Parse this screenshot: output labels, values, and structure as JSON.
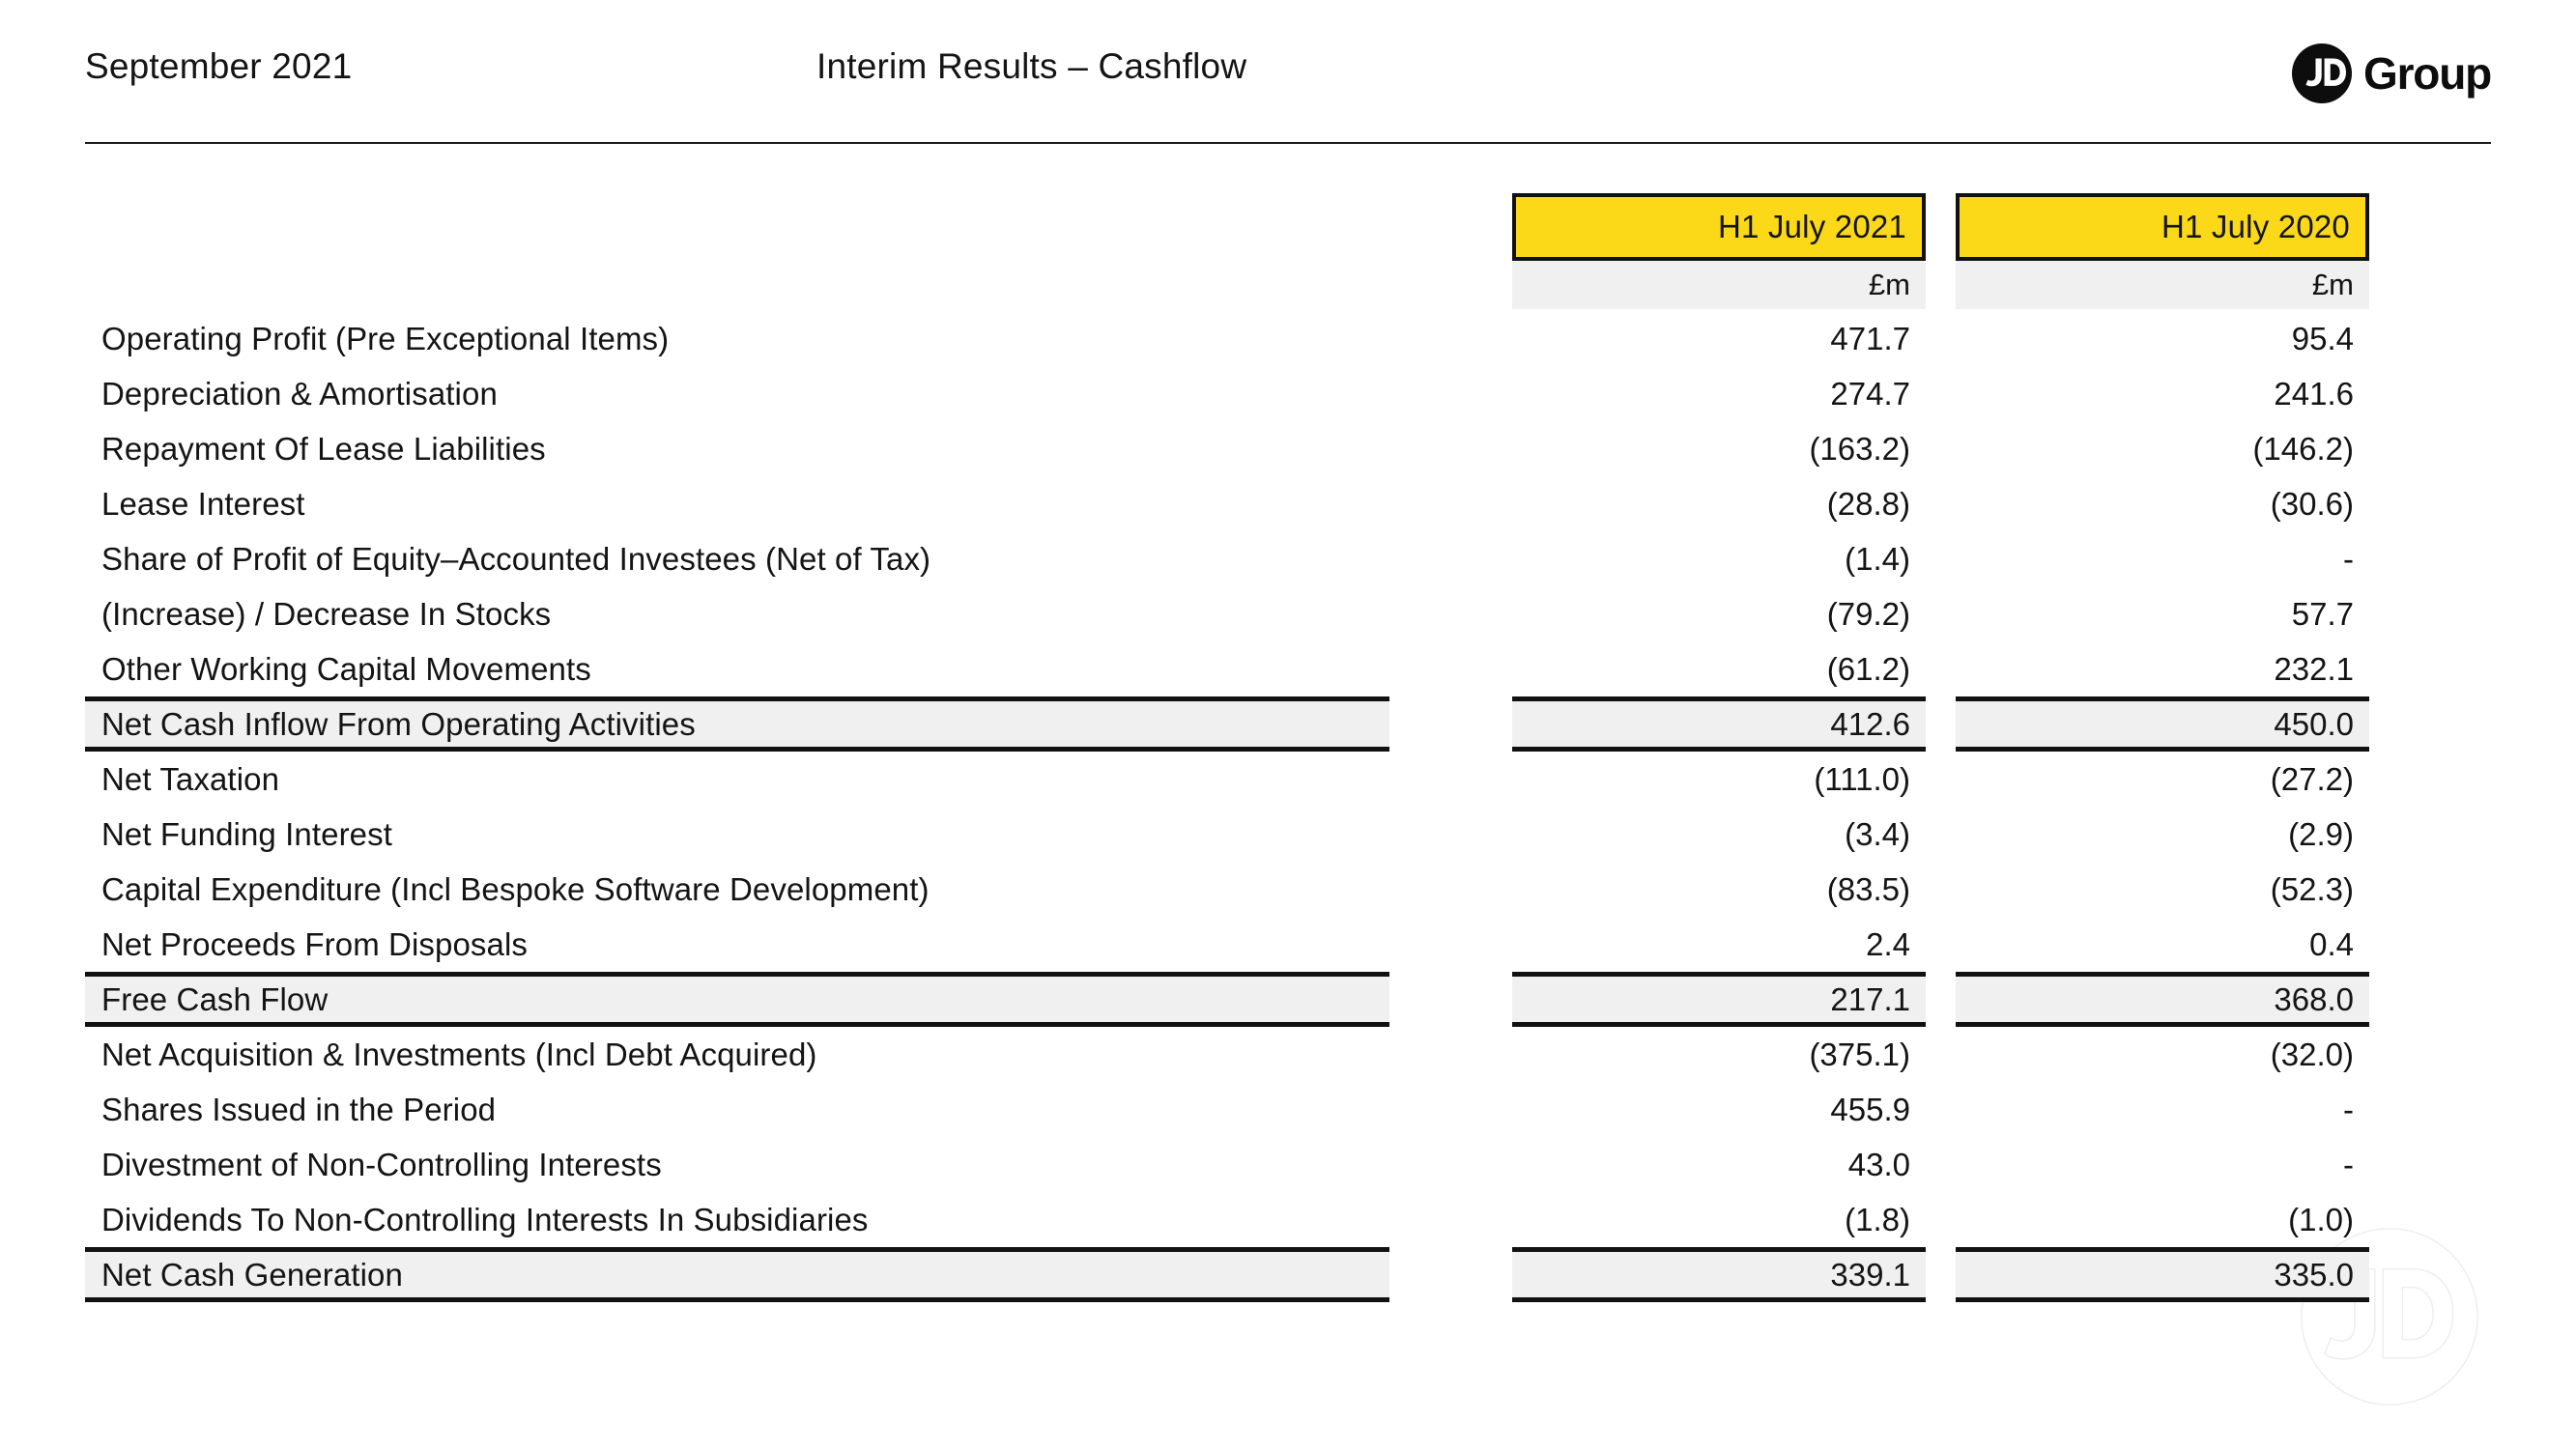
{
  "header": {
    "date": "September 2021",
    "title": "Interim Results – Cashflow",
    "logo_word": "Group",
    "logo_mark": "jd-roundel"
  },
  "colors": {
    "accent_yellow": "#FBD919",
    "band_grey": "#F0F0F0",
    "rule_black": "#111111",
    "text": "#141414"
  },
  "table": {
    "columns": [
      {
        "year": "H1 July 2021",
        "unit": "£m"
      },
      {
        "year": "H1 July 2020",
        "unit": "£m"
      }
    ],
    "rows": [
      {
        "label": "Operating Profit (Pre Exceptional Items)",
        "v0": "471.7",
        "v1": "95.4",
        "subtotal": false
      },
      {
        "label": "Depreciation & Amortisation",
        "v0": "274.7",
        "v1": "241.6",
        "subtotal": false
      },
      {
        "label": "Repayment Of Lease Liabilities",
        "v0": "(163.2)",
        "v1": "(146.2)",
        "subtotal": false
      },
      {
        "label": "Lease Interest",
        "v0": "(28.8)",
        "v1": "(30.6)",
        "subtotal": false
      },
      {
        "label": "Share of Profit of Equity–Accounted Investees (Net of Tax)",
        "v0": "(1.4)",
        "v1": "-",
        "subtotal": false
      },
      {
        "label": "(Increase) / Decrease In Stocks",
        "v0": "(79.2)",
        "v1": "57.7",
        "subtotal": false
      },
      {
        "label": "Other Working Capital Movements",
        "v0": "(61.2)",
        "v1": "232.1",
        "subtotal": false
      },
      {
        "label": "Net Cash Inflow From Operating Activities",
        "v0": "412.6",
        "v1": "450.0",
        "subtotal": true
      },
      {
        "label": "Net Taxation",
        "v0": "(111.0)",
        "v1": "(27.2)",
        "subtotal": false
      },
      {
        "label": "Net Funding Interest",
        "v0": "(3.4)",
        "v1": "(2.9)",
        "subtotal": false
      },
      {
        "label": "Capital Expenditure (Incl Bespoke Software Development)",
        "v0": "(83.5)",
        "v1": "(52.3)",
        "subtotal": false
      },
      {
        "label": "Net Proceeds From Disposals",
        "v0": "2.4",
        "v1": "0.4",
        "subtotal": false
      },
      {
        "label": "Free Cash Flow",
        "v0": "217.1",
        "v1": "368.0",
        "subtotal": true
      },
      {
        "label": "Net Acquisition & Investments (Incl Debt Acquired)",
        "v0": "(375.1)",
        "v1": "(32.0)",
        "subtotal": false
      },
      {
        "label": "Shares Issued in the Period",
        "v0": "455.9",
        "v1": "-",
        "subtotal": false
      },
      {
        "label": "Divestment of Non-Controlling Interests",
        "v0": "43.0",
        "v1": "-",
        "subtotal": false
      },
      {
        "label": "Dividends To Non-Controlling Interests In Subsidiaries",
        "v0": "(1.8)",
        "v1": "(1.0)",
        "subtotal": false
      },
      {
        "label": "Net Cash Generation",
        "v0": "339.1",
        "v1": "335.0",
        "subtotal": true
      }
    ]
  }
}
